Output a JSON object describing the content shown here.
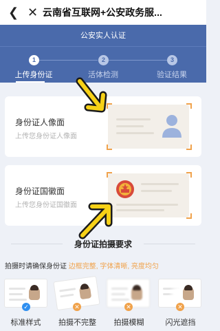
{
  "header": {
    "back_icon": "back-icon",
    "close_icon": "close-icon",
    "title": "云南省互联网+公安政务服..."
  },
  "hero": {
    "subtitle": "公安实人认证"
  },
  "steps": [
    {
      "number": "1",
      "label": "上传身份证",
      "active": true
    },
    {
      "number": "2",
      "label": "活体检测",
      "active": false
    },
    {
      "number": "3",
      "label": "验证结果",
      "active": false
    }
  ],
  "cards": {
    "portrait": {
      "title": "身份证人像面",
      "subtitle": "上传您身份证人像面"
    },
    "emblem": {
      "title": "身份证国徽面",
      "subtitle": "上传您身份证国徽面"
    }
  },
  "requirements": {
    "section_title": "身份证拍摄要求",
    "prefix": "拍摄时请确保身份证",
    "highlights": "边框完整, 字体清晰, 亮度均匀"
  },
  "samples": [
    {
      "label": "标准样式",
      "status": "ok"
    },
    {
      "label": "拍摄不完整",
      "status": "bad"
    },
    {
      "label": "拍摄模糊",
      "status": "bad"
    },
    {
      "label": "闪光遮挡",
      "status": "bad"
    }
  ],
  "colors": {
    "primary": "#4a6aab",
    "accent": "#f0a24b",
    "ok": "#2f8ff0"
  }
}
